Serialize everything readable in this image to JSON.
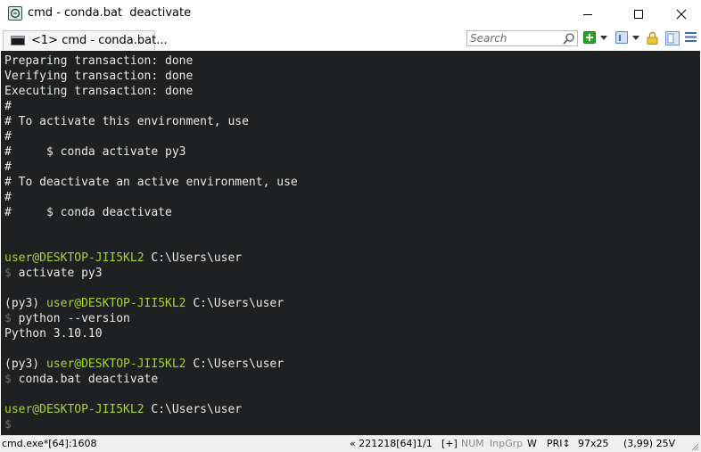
{
  "window": {
    "title": "cmd - conda.bat  deactivate",
    "app_icon": "conemu-icon",
    "controls": [
      "minimize-icon",
      "maximize-icon",
      "close-icon"
    ]
  },
  "tabs": [
    {
      "label": "<1> cmd - conda.bat...",
      "icon": "console-icon"
    }
  ],
  "toolbar": {
    "search_placeholder": "Search",
    "icons": [
      "search-icon",
      "new-console-icon",
      "dropdown-icon",
      "tab-list-icon",
      "dropdown-icon",
      "lock-icon",
      "split-view-icon",
      "menu-icon"
    ]
  },
  "console": {
    "lines": [
      [
        {
          "t": "Preparing transaction: done"
        }
      ],
      [
        {
          "t": "Verifying transaction: done"
        }
      ],
      [
        {
          "t": "Executing transaction: done"
        }
      ],
      [
        {
          "t": "#"
        }
      ],
      [
        {
          "t": "# To activate this environment, use"
        }
      ],
      [
        {
          "t": "#"
        }
      ],
      [
        {
          "t": "#     $ conda activate py3"
        }
      ],
      [
        {
          "t": "#"
        }
      ],
      [
        {
          "t": "# To deactivate an active environment, use"
        }
      ],
      [
        {
          "t": "#"
        }
      ],
      [
        {
          "t": "#     $ conda deactivate"
        }
      ],
      [],
      [],
      [
        {
          "t": "user@DESKTOP-JII5KL2 ",
          "c": "green"
        },
        {
          "t": "C:\\Users\\user"
        }
      ],
      [
        {
          "t": "$ ",
          "c": "dim"
        },
        {
          "t": "activate py3"
        }
      ],
      [],
      [
        {
          "t": "(py3) "
        },
        {
          "t": "user@DESKTOP-JII5KL2 ",
          "c": "green"
        },
        {
          "t": "C:\\Users\\user"
        }
      ],
      [
        {
          "t": "$ ",
          "c": "dim"
        },
        {
          "t": "python --version"
        }
      ],
      [
        {
          "t": "Python 3.10.10"
        }
      ],
      [],
      [
        {
          "t": "(py3) "
        },
        {
          "t": "user@DESKTOP-JII5KL2 ",
          "c": "green"
        },
        {
          "t": "C:\\Users\\user"
        }
      ],
      [
        {
          "t": "$ ",
          "c": "dim"
        },
        {
          "t": "conda.bat deactivate"
        }
      ],
      [],
      [
        {
          "t": "user@DESKTOP-JII5KL2 ",
          "c": "green"
        },
        {
          "t": "C:\\Users\\user"
        }
      ],
      [
        {
          "t": "$",
          "c": "dim"
        }
      ]
    ],
    "colors": {
      "background": "#1f2021",
      "text": "#e8e8e8",
      "prompt": "#a6d52a",
      "dollar": "#6e6e6e"
    }
  },
  "statusbar": {
    "process": "cmd.exe*[64]:1608",
    "pid": "« 221218[64]",
    "console_index": "1/1",
    "plus": "[+]",
    "num": "NUM",
    "inpgrp": "InpGrp",
    "w": "W",
    "pri": "PRI↕",
    "size": "97x25",
    "cursor": "(3,99) 25V"
  }
}
